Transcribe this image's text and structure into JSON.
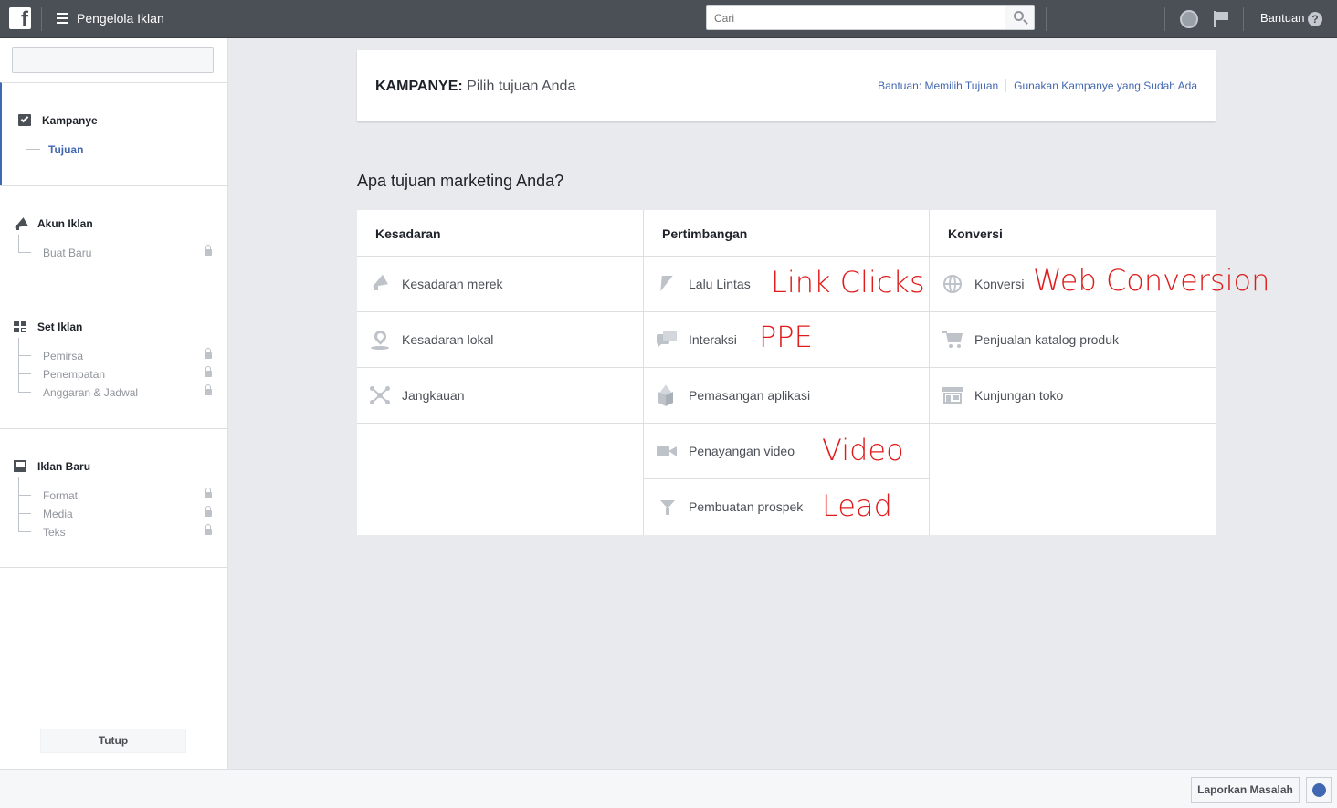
{
  "topbar": {
    "app_title": "Pengelola Iklan",
    "search_placeholder": "Cari",
    "help_label": "Bantuan",
    "help_glyph": "?",
    "logo_glyph": "f"
  },
  "sidebar": {
    "sections": [
      {
        "title": "Kampanye",
        "icon": "checkbox-icon",
        "items": [
          {
            "label": "Tujuan",
            "locked": false,
            "current": true
          }
        ]
      },
      {
        "title": "Akun Iklan",
        "icon": "megaphone-icon",
        "items": [
          {
            "label": "Buat Baru",
            "locked": true
          }
        ]
      },
      {
        "title": "Set Iklan",
        "icon": "grid-icon",
        "items": [
          {
            "label": "Pemirsa",
            "locked": true
          },
          {
            "label": "Penempatan",
            "locked": true
          },
          {
            "label": "Anggaran & Jadwal",
            "locked": true
          }
        ]
      },
      {
        "title": "Iklan Baru",
        "icon": "ad-preview-icon",
        "items": [
          {
            "label": "Format",
            "locked": true
          },
          {
            "label": "Media",
            "locked": true
          },
          {
            "label": "Teks",
            "locked": true
          }
        ]
      }
    ],
    "close_label": "Tutup"
  },
  "header": {
    "title_bold": "KAMPANYE:",
    "title_rest": " Pilih tujuan Anda",
    "link_help": "Bantuan: Memilih Tujuan",
    "link_existing": "Gunakan Kampanye yang Sudah Ada"
  },
  "question": "Apa tujuan marketing Anda?",
  "objectives": {
    "awareness": {
      "heading": "Kesadaran",
      "items": [
        {
          "label": "Kesadaran merek",
          "icon": "megaphone-icon"
        },
        {
          "label": "Kesadaran lokal",
          "icon": "map-pin-icon"
        },
        {
          "label": "Jangkauan",
          "icon": "reach-icon"
        }
      ]
    },
    "consideration": {
      "heading": "Pertimbangan",
      "items": [
        {
          "label": "Lalu Lintas",
          "icon": "cursor-icon",
          "annotation": "Link Clicks"
        },
        {
          "label": "Interaksi",
          "icon": "chat-bubbles-icon",
          "annotation": "PPE"
        },
        {
          "label": "Pemasangan aplikasi",
          "icon": "box-icon"
        },
        {
          "label": "Penayangan video",
          "icon": "video-camera-icon",
          "annotation": "Video"
        },
        {
          "label": "Pembuatan prospek",
          "icon": "funnel-icon",
          "annotation": "Lead"
        }
      ]
    },
    "conversion": {
      "heading": "Konversi",
      "items": [
        {
          "label": "Konversi",
          "icon": "globe-icon",
          "annotation": "Web Conversion"
        },
        {
          "label": "Penjualan katalog produk",
          "icon": "shopping-cart-icon"
        },
        {
          "label": "Kunjungan toko",
          "icon": "store-icon"
        }
      ]
    }
  },
  "footer": {
    "report_label": "Laporkan Masalah"
  },
  "colors": {
    "topbar": "#4b4f56",
    "link": "#4267b2",
    "annotation": "#e01b1b",
    "icon_gray": "#bec2c9"
  }
}
